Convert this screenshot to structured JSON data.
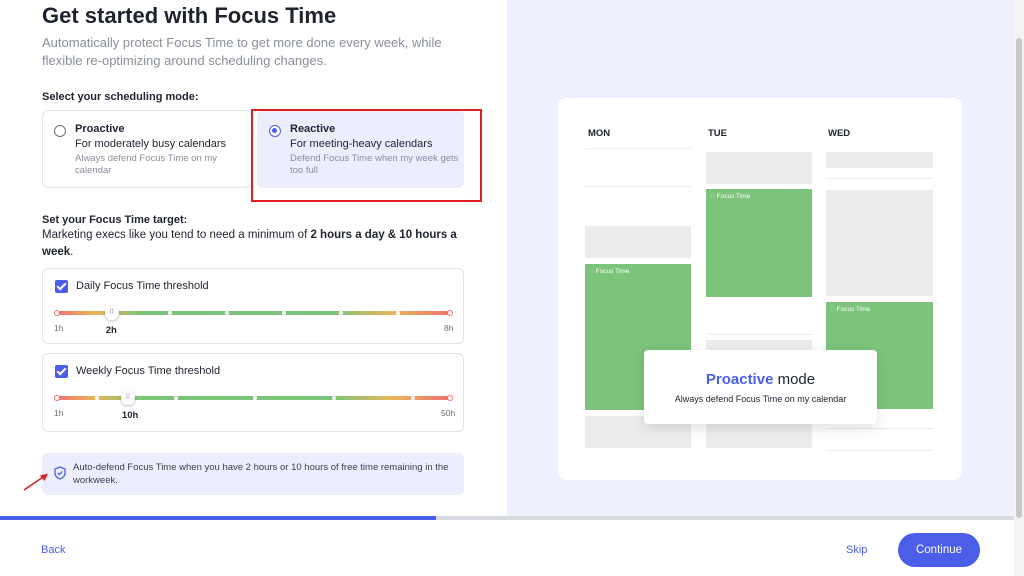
{
  "header": {
    "title": "Get started with Focus Time",
    "subtitle": "Automatically protect Focus Time to get more done every week, while flexible re-optimizing around scheduling changes."
  },
  "scheduling": {
    "label": "Select your scheduling mode:",
    "options": [
      {
        "name": "Proactive",
        "sub": "For moderately busy calendars",
        "desc": "Always defend Focus Time on my calendar",
        "selected": false
      },
      {
        "name": "Reactive",
        "sub": "For meeting-heavy calendars",
        "desc": "Defend Focus Time when my week gets too full",
        "selected": true
      }
    ]
  },
  "target": {
    "label": "Set your Focus Time target:",
    "text_pre": "Marketing execs like you tend to need a minimum of ",
    "text_bold": "2 hours a day & 10 hours a week",
    "text_post": "."
  },
  "daily": {
    "label": "Daily Focus Time threshold",
    "checked": true,
    "min": "1h",
    "max": "8h",
    "value": "2h",
    "value_hours": 2,
    "range_hours": [
      1,
      8
    ]
  },
  "weekly": {
    "label": "Weekly Focus Time threshold",
    "checked": true,
    "min": "1h",
    "max": "50h",
    "value": "10h",
    "value_hours": 10,
    "range_hours": [
      1,
      50
    ]
  },
  "info": {
    "text": "Auto-defend Focus Time when you have 2 hours or 10 hours of free time remaining in the workweek."
  },
  "preview": {
    "days": [
      "MON",
      "TUE",
      "WED"
    ],
    "focus_label": "Focus Time",
    "mode_accent": "Proactive",
    "mode_word": "mode",
    "mode_desc": "Always defend Focus Time on my calendar"
  },
  "progress": {
    "fraction": 0.43
  },
  "footer": {
    "back": "Back",
    "skip": "Skip",
    "continue": "Continue"
  },
  "colors": {
    "accent": "#4a5ee8",
    "focus_green": "#7cc47a",
    "highlight_red": "#e02020",
    "panel_bg": "#eef0fd"
  }
}
